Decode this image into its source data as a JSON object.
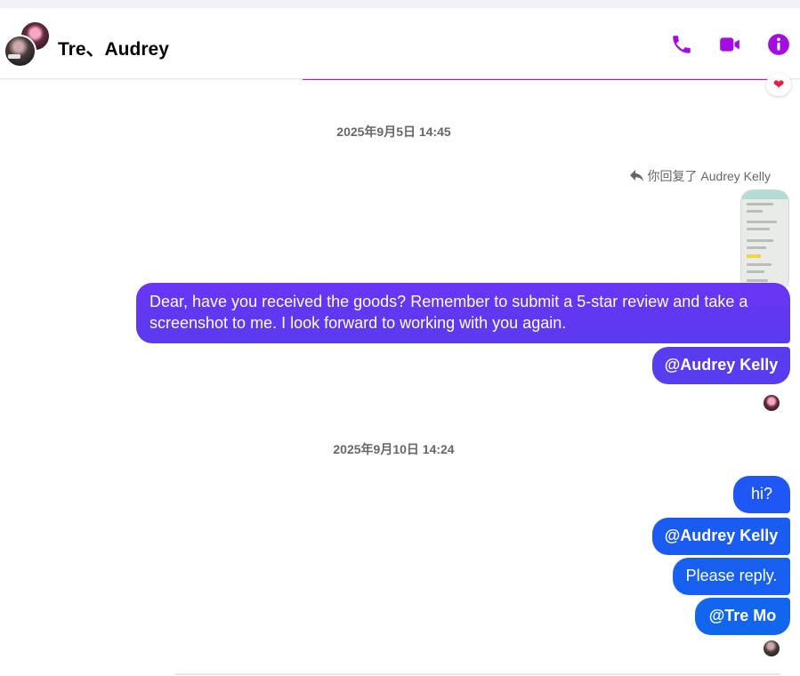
{
  "header": {
    "title": "Tre、Audrey",
    "icons": {
      "call": "phone-icon",
      "video": "video-camera-icon",
      "info": "info-icon"
    },
    "accent_color": "#a30de0"
  },
  "reaction": {
    "emoji": "❤"
  },
  "timestamps": [
    "2025年9月5日 14:45",
    "2025年9月10日 14:24"
  ],
  "reply_note": "你回复了 Audrey Kelly",
  "messages": [
    {
      "text": "Dear, have you received the goods? Remember to submit a 5-star review and take a screenshot to me. I look forward to working with you again."
    },
    {
      "text": "@Audrey Kelly"
    },
    {
      "text": "hi?"
    },
    {
      "text": "@Audrey Kelly"
    },
    {
      "text": "Please reply."
    },
    {
      "text": "@Tre Mo"
    }
  ],
  "colors": {
    "bubble_purple": "#5a3aef",
    "bubble_blue": "#1a5bf2",
    "timestamp_gray": "#65676b"
  }
}
